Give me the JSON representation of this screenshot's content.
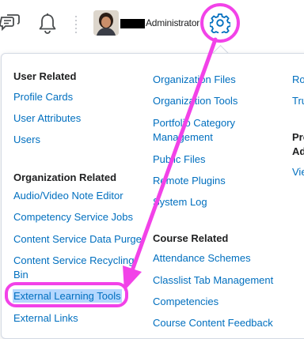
{
  "header": {
    "user_role": "Administrator"
  },
  "menu": {
    "col1": {
      "user_related_heading": "User Related",
      "profile_cards": "Profile Cards",
      "user_attributes": "User Attributes",
      "users": "Users",
      "org_related_heading": "Organization Related",
      "audio_video_note_editor": "Audio/Video Note Editor",
      "competency_service_jobs": "Competency Service Jobs",
      "content_service_data_purge": "Content Service Data Purge",
      "content_service_recycling_bin": "Content Service Recycling Bin",
      "external_learning_tools": "External Learning Tools",
      "external_links": "External Links"
    },
    "col2": {
      "organization_files": "Organization Files",
      "organization_tools": "Organization Tools",
      "portfolio_category_management": "Portfolio Category Management",
      "public_files": "Public Files",
      "remote_plugins": "Remote Plugins",
      "system_log": "System Log",
      "course_related_heading": "Course Related",
      "attendance_schemes": "Attendance Schemes",
      "classlist_tab_management": "Classlist Tab Management",
      "competencies": "Competencies",
      "course_content_feedback": "Course Content Feedback"
    },
    "col3": {
      "item_ro": "Ro",
      "item_tru": "Tru",
      "heading_pro": "Pro",
      "heading_ad": "Ad",
      "item_vie": "Vie"
    }
  },
  "colors": {
    "link": "#006fbf",
    "annotation": "#f242e8",
    "selection": "#b4d7fe"
  }
}
